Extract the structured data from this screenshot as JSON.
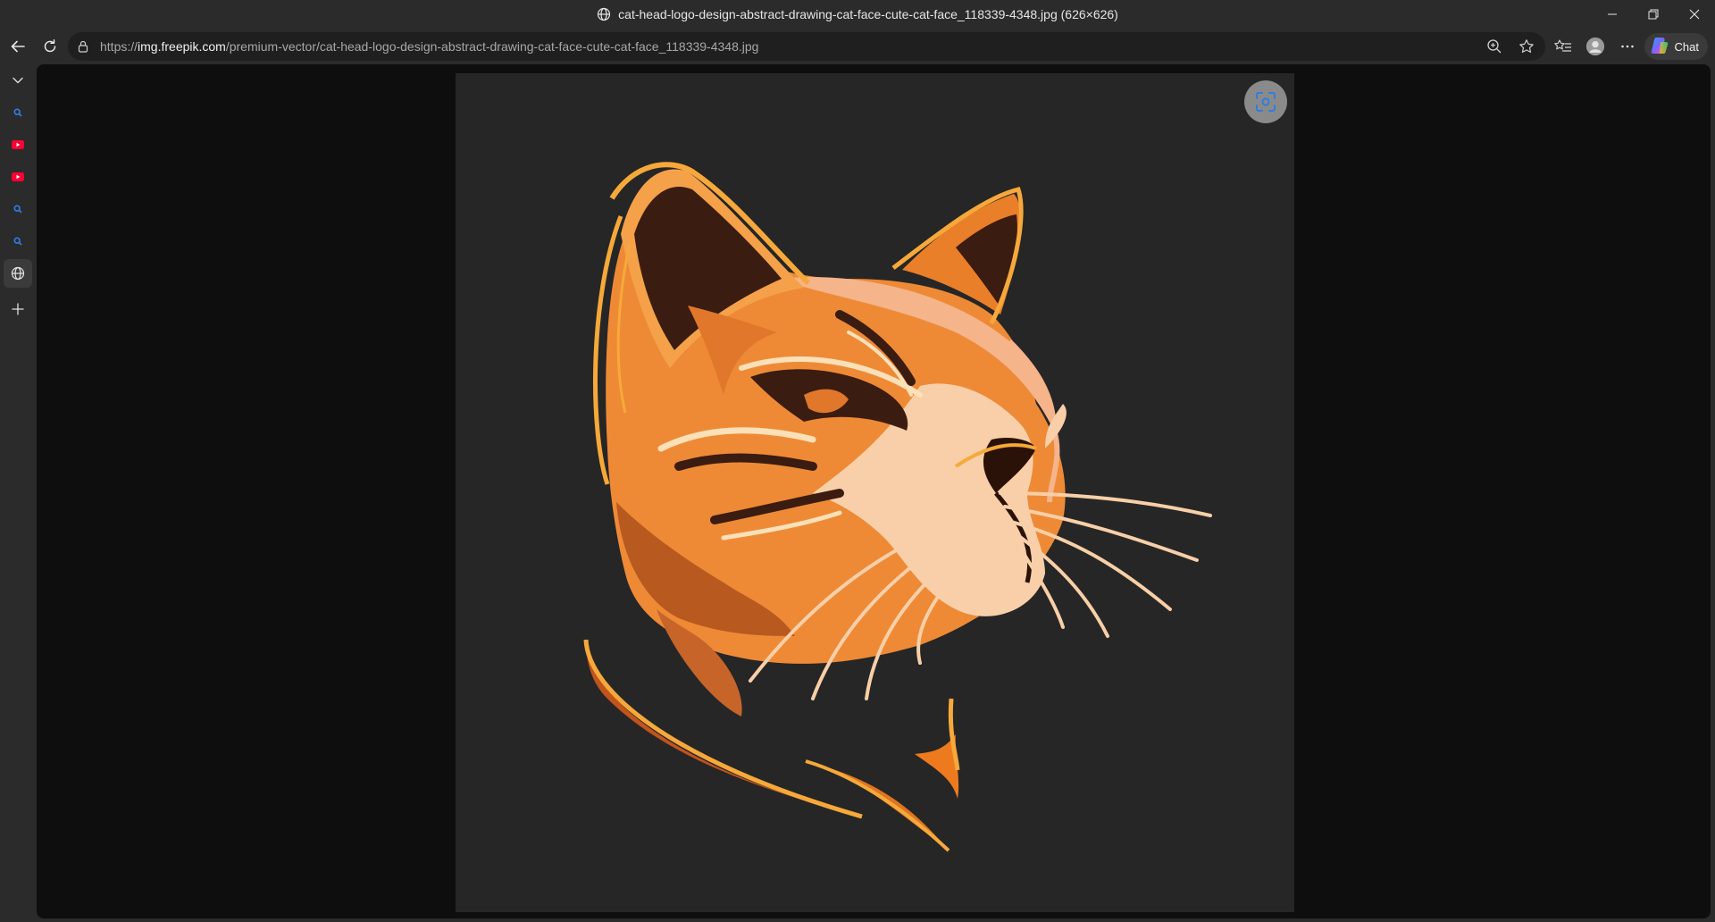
{
  "window": {
    "title": "cat-head-logo-design-abstract-drawing-cat-face-cute-cat-face_118339-4348.jpg (626×626)",
    "controls": [
      "minimize-icon",
      "restore-icon",
      "close-icon"
    ]
  },
  "toolbar": {
    "url_scheme": "https://",
    "url_host": "img.freepik.com",
    "url_path": "/premium-vector/cat-head-logo-design-abstract-drawing-cat-face-cute-cat-face_118339-4348.jpg",
    "chat_label": "Chat",
    "icons": [
      "back-icon",
      "refresh-icon",
      "lock-icon",
      "zoom-icon",
      "favorite-star-icon",
      "favorites-list-icon",
      "profile-icon",
      "more-icon",
      "copilot-icon"
    ]
  },
  "sidebar": {
    "items": [
      {
        "icon": "chevron-down-icon"
      },
      {
        "icon": "search-icon",
        "color": "#2f7de1"
      },
      {
        "icon": "youtube-icon",
        "color": "#ff0033"
      },
      {
        "icon": "youtube-icon",
        "color": "#ff0033"
      },
      {
        "icon": "search-icon",
        "color": "#2f7de1"
      },
      {
        "icon": "search-icon",
        "color": "#2f7de1"
      },
      {
        "icon": "globe-icon"
      },
      {
        "icon": "add-icon"
      }
    ]
  },
  "content": {
    "image_subject": "orange cat head logo",
    "visual_search_icon": "visual-search-icon"
  },
  "colors": {
    "chrome": "#2b2b2b",
    "address_bar": "#1f1f1f",
    "viewer_bg": "#0e0e0e",
    "image_bg": "#262626",
    "cat_orange": "#f08a2c",
    "cat_dark": "#3b1c10",
    "cat_cream": "#f8cfa8",
    "cat_outline": "#f6a93a"
  }
}
